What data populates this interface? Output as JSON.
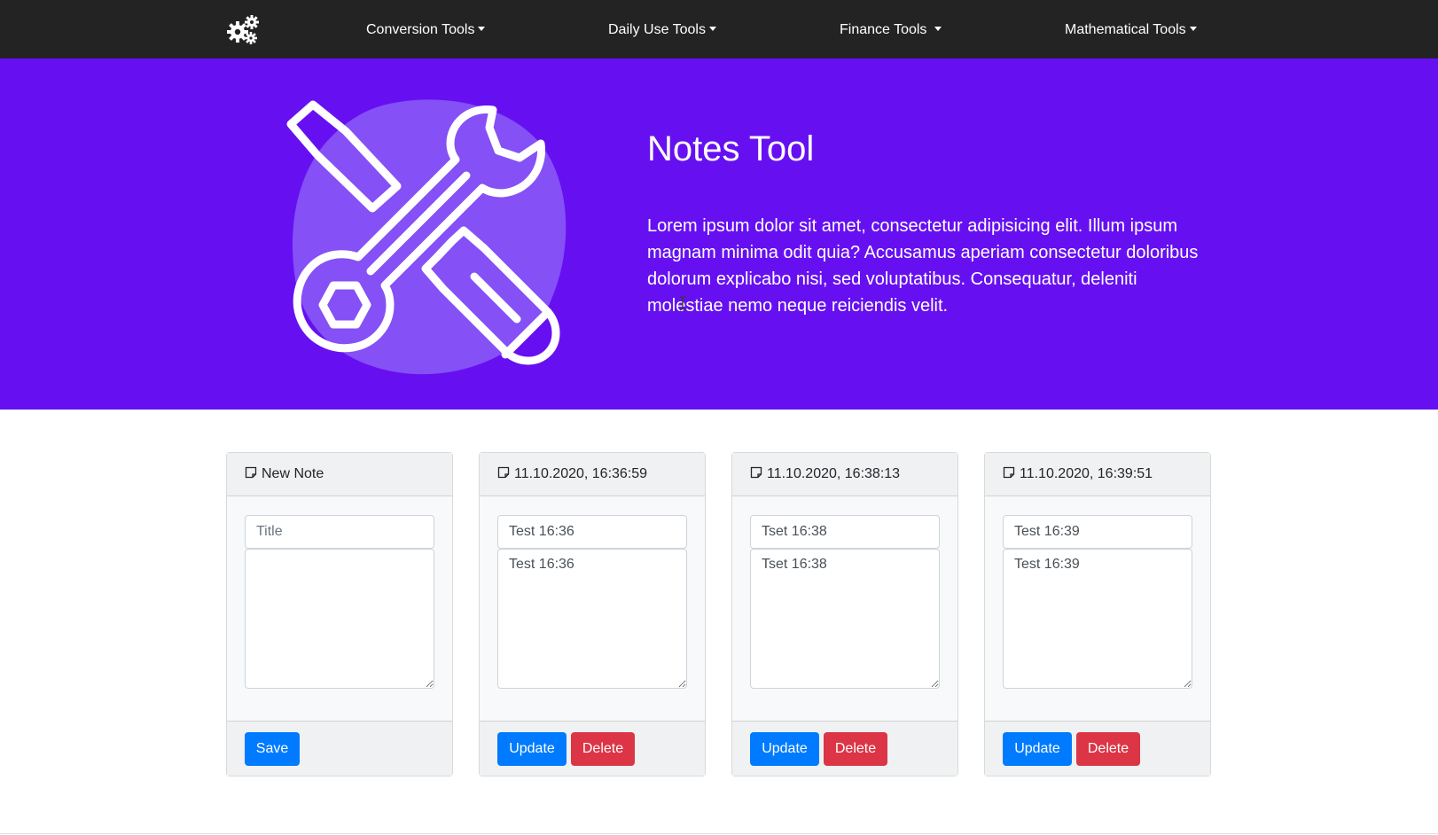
{
  "navbar": {
    "brand_icon": "gears-icon",
    "items": [
      {
        "label": "Conversion Tools"
      },
      {
        "label": "Daily Use Tools"
      },
      {
        "label": "Finance Tools"
      },
      {
        "label": "Mathematical Tools"
      }
    ]
  },
  "hero": {
    "illustration_icon": "wrench-screwdriver-icon",
    "title": "Notes Tool",
    "text": "Lorem ipsum dolor sit amet, consectetur adipisicing elit. Illum ipsum magnam minima odit quia? Accusamus aperiam consectetur doloribus dolorum explicabo nisi, sed voluptatibus. Consequatur, deleniti molestiae nemo neque reiciendis velit.",
    "background_color": "#6610f2"
  },
  "new_note": {
    "header": "New Note",
    "title_placeholder": "Title",
    "title_value": "",
    "body_value": "",
    "save_label": "Save"
  },
  "notes": [
    {
      "header": "11.10.2020, 16:36:59",
      "title": "Test 16:36",
      "body": "Test 16:36",
      "update_label": "Update",
      "delete_label": "Delete"
    },
    {
      "header": "11.10.2020, 16:38:13",
      "title": "Tset 16:38",
      "body": "Tset 16:38",
      "update_label": "Update",
      "delete_label": "Delete"
    },
    {
      "header": "11.10.2020, 16:39:51",
      "title": "Test 16:39",
      "body": "Test 16:39",
      "update_label": "Update",
      "delete_label": "Delete"
    }
  ],
  "colors": {
    "navbar": "#232323",
    "primary": "#007bff",
    "danger": "#dc3545"
  }
}
